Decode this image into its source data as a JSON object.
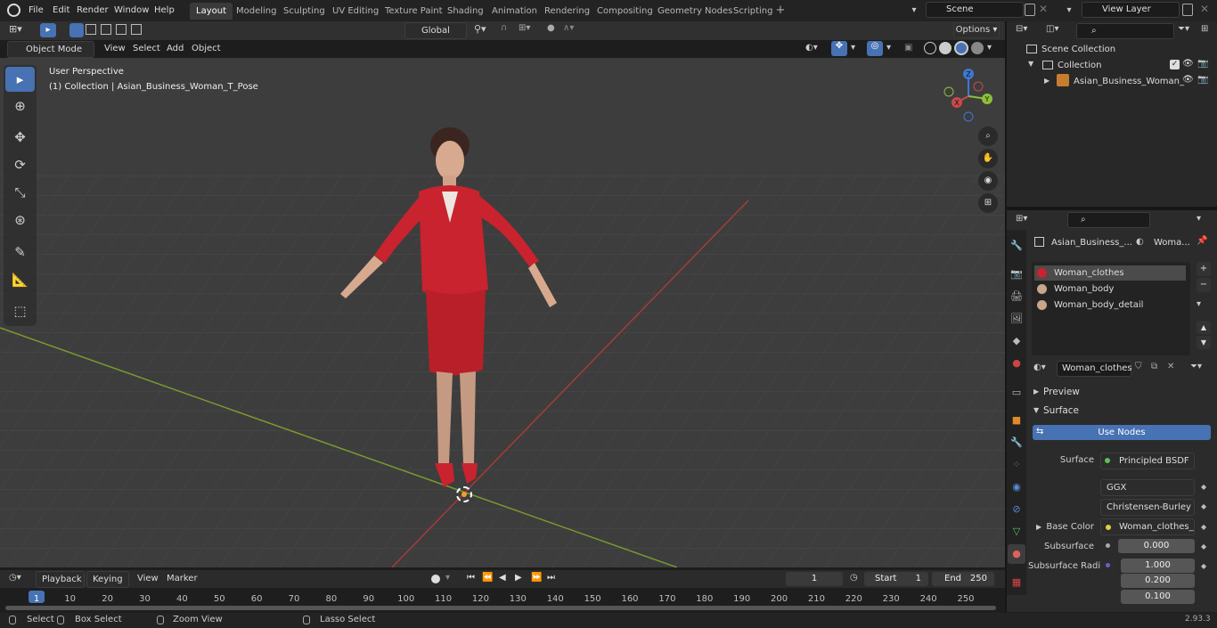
{
  "menu": [
    "File",
    "Edit",
    "Render",
    "Window",
    "Help"
  ],
  "workspaces": [
    "Layout",
    "Modeling",
    "Sculpting",
    "UV Editing",
    "Texture Paint",
    "Shading",
    "Animation",
    "Rendering",
    "Compositing",
    "Geometry Nodes",
    "Scripting"
  ],
  "active_workspace": "Layout",
  "scene": "Scene",
  "view_layer": "View Layer",
  "transform_orientation": "Global",
  "options_label": "Options",
  "mode": "Object Mode",
  "viewport_menu": [
    "View",
    "Select",
    "Add",
    "Object"
  ],
  "overlay": {
    "line1": "User Perspective",
    "line2": "(1) Collection | Asian_Business_Woman_T_Pose"
  },
  "outliner": {
    "root": "Scene Collection",
    "collection": "Collection",
    "object": "Asian_Business_Woman_"
  },
  "props": {
    "object_name": "Asian_Business_...",
    "material_short": "Woma...",
    "slots": [
      "Woman_clothes",
      "Woman_body",
      "Woman_body_detail"
    ],
    "material": "Woman_clothes",
    "preview": "Preview",
    "surface_section": "Surface",
    "use_nodes": "Use Nodes",
    "surface_label": "Surface",
    "surface_value": "Principled BSDF",
    "distribution": "GGX",
    "subsurface_method": "Christensen-Burley",
    "base_color_label": "Base Color",
    "base_color_value": "Woman_clothes_Diff...",
    "subsurface_label": "Subsurface",
    "subsurface_value": "0.000",
    "subsurface_radius_label": "Subsurface Radi...",
    "radius": [
      "1.000",
      "0.200",
      "0.100"
    ]
  },
  "timeline": {
    "menus": [
      "Playback",
      "Keying",
      "View",
      "Marker"
    ],
    "current_frame": "1",
    "start_label": "Start",
    "start": "1",
    "end_label": "End",
    "end": "250",
    "ticks": [
      "1",
      "10",
      "20",
      "30",
      "40",
      "50",
      "60",
      "70",
      "80",
      "90",
      "100",
      "110",
      "120",
      "130",
      "140",
      "150",
      "160",
      "170",
      "180",
      "190",
      "200",
      "210",
      "220",
      "230",
      "240",
      "250"
    ]
  },
  "status": {
    "select": "Select",
    "box_select": "Box Select",
    "zoom_view": "Zoom View",
    "lasso_select": "Lasso Select",
    "version": "2.93.3"
  },
  "colors": {
    "accent": "#4772b3",
    "x_axis": "#c84a4a",
    "y_axis": "#8dbf3a",
    "z_axis": "#3e78d6",
    "suit": "#c8232e"
  }
}
